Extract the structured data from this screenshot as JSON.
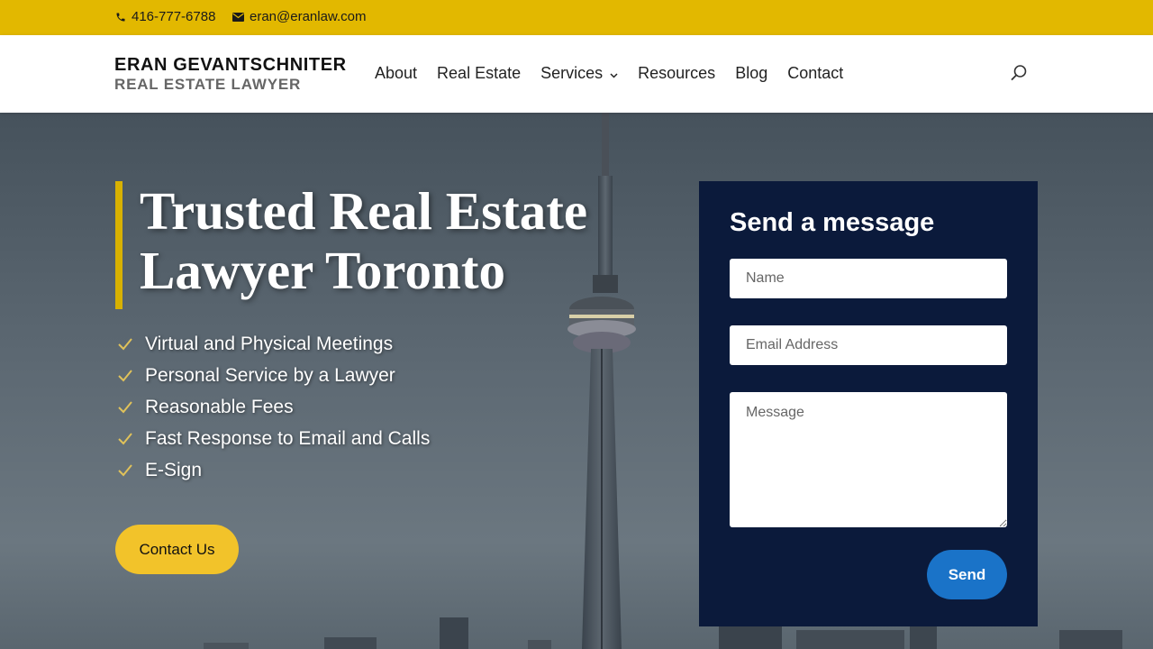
{
  "topbar": {
    "phone": "416-777-6788",
    "email": "eran@eranlaw.com",
    "background": "#e2b800"
  },
  "header": {
    "logo_name": "ERAN GEVANTSCHNITER",
    "logo_subtitle": "REAL ESTATE LAWYER",
    "nav": [
      {
        "label": "About"
      },
      {
        "label": "Real Estate"
      },
      {
        "label": "Services",
        "has_dropdown": true
      },
      {
        "label": "Resources"
      },
      {
        "label": "Blog"
      },
      {
        "label": "Contact"
      }
    ],
    "search_icon": "search-icon"
  },
  "hero": {
    "title_line1": "Trusted Real Estate",
    "title_line2": "Lawyer Toronto",
    "features": [
      "Virtual and Physical  Meetings",
      "Personal Service by a Lawyer",
      "Reasonable Fees",
      "Fast Response to Email and Calls",
      "E-Sign"
    ],
    "cta_label": "Contact Us",
    "accent": "#f2c32a"
  },
  "form": {
    "title": "Send a message",
    "name_placeholder": "Name",
    "email_placeholder": "Email Address",
    "message_placeholder": "Message",
    "send_label": "Send",
    "background": "#0b1a3b",
    "send_color": "#1a73c8"
  }
}
